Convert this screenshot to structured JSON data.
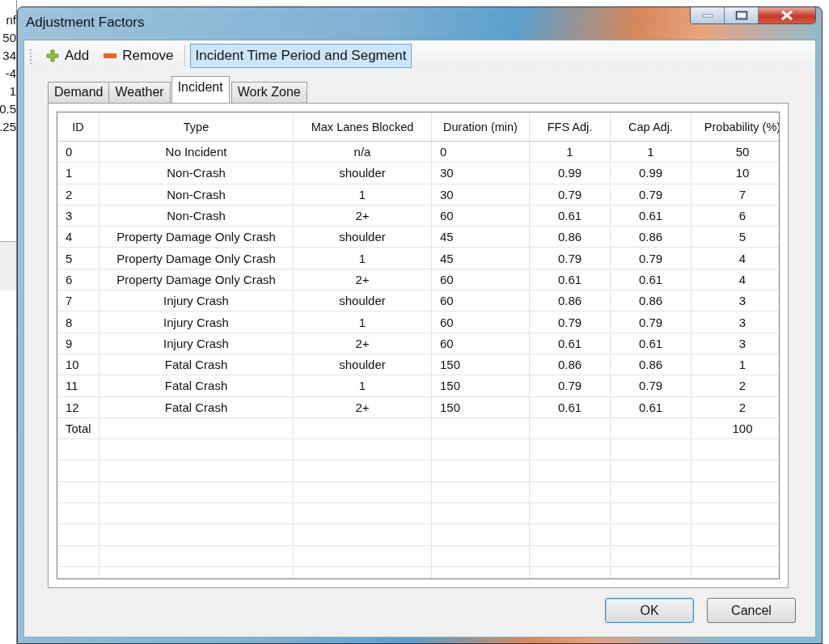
{
  "background_window": {
    "cells": [
      "nf",
      "50",
      "34",
      "-4",
      "1",
      "0.5",
      ".25"
    ]
  },
  "window": {
    "title": "Adjustment Factors"
  },
  "toolbar": [
    {
      "kind": "add",
      "label": "Add"
    },
    {
      "kind": "remove",
      "label": "Remove"
    },
    {
      "kind": "toggle",
      "label": "Incident Time Period and Segment",
      "checked": true
    }
  ],
  "tabs": [
    {
      "label": "Demand",
      "selected": false
    },
    {
      "label": "Weather",
      "selected": false
    },
    {
      "label": "Incident",
      "selected": true
    },
    {
      "label": "Work Zone",
      "selected": false
    }
  ],
  "table": {
    "columns": [
      "ID",
      "Type",
      "Max Lanes Blocked",
      "Duration (min)",
      "FFS Adj.",
      "Cap Adj.",
      "Probability (%)"
    ],
    "rows": [
      [
        "0",
        "No Incident",
        "n/a",
        "0",
        "1",
        "1",
        "50"
      ],
      [
        "1",
        "Non-Crash",
        "shoulder",
        "30",
        "0.99",
        "0.99",
        "10"
      ],
      [
        "2",
        "Non-Crash",
        "1",
        "30",
        "0.79",
        "0.79",
        "7"
      ],
      [
        "3",
        "Non-Crash",
        "2+",
        "60",
        "0.61",
        "0.61",
        "6"
      ],
      [
        "4",
        "Property Damage Only Crash",
        "shoulder",
        "45",
        "0.86",
        "0.86",
        "5"
      ],
      [
        "5",
        "Property Damage Only Crash",
        "1",
        "45",
        "0.79",
        "0.79",
        "4"
      ],
      [
        "6",
        "Property Damage Only Crash",
        "2+",
        "60",
        "0.61",
        "0.61",
        "4"
      ],
      [
        "7",
        "Injury Crash",
        "shoulder",
        "60",
        "0.86",
        "0.86",
        "3"
      ],
      [
        "8",
        "Injury Crash",
        "1",
        "60",
        "0.79",
        "0.79",
        "3"
      ],
      [
        "9",
        "Injury Crash",
        "2+",
        "60",
        "0.61",
        "0.61",
        "3"
      ],
      [
        "10",
        "Fatal Crash",
        "shoulder",
        "150",
        "0.86",
        "0.86",
        "1"
      ],
      [
        "11",
        "Fatal Crash",
        "1",
        "150",
        "0.79",
        "0.79",
        "2"
      ],
      [
        "12",
        "Fatal Crash",
        "2+",
        "150",
        "0.61",
        "0.61",
        "2"
      ]
    ],
    "total": {
      "label": "Total",
      "probability": "100"
    }
  },
  "buttons": [
    {
      "label": "OK",
      "default": true
    },
    {
      "label": "Cancel",
      "default": false
    }
  ]
}
